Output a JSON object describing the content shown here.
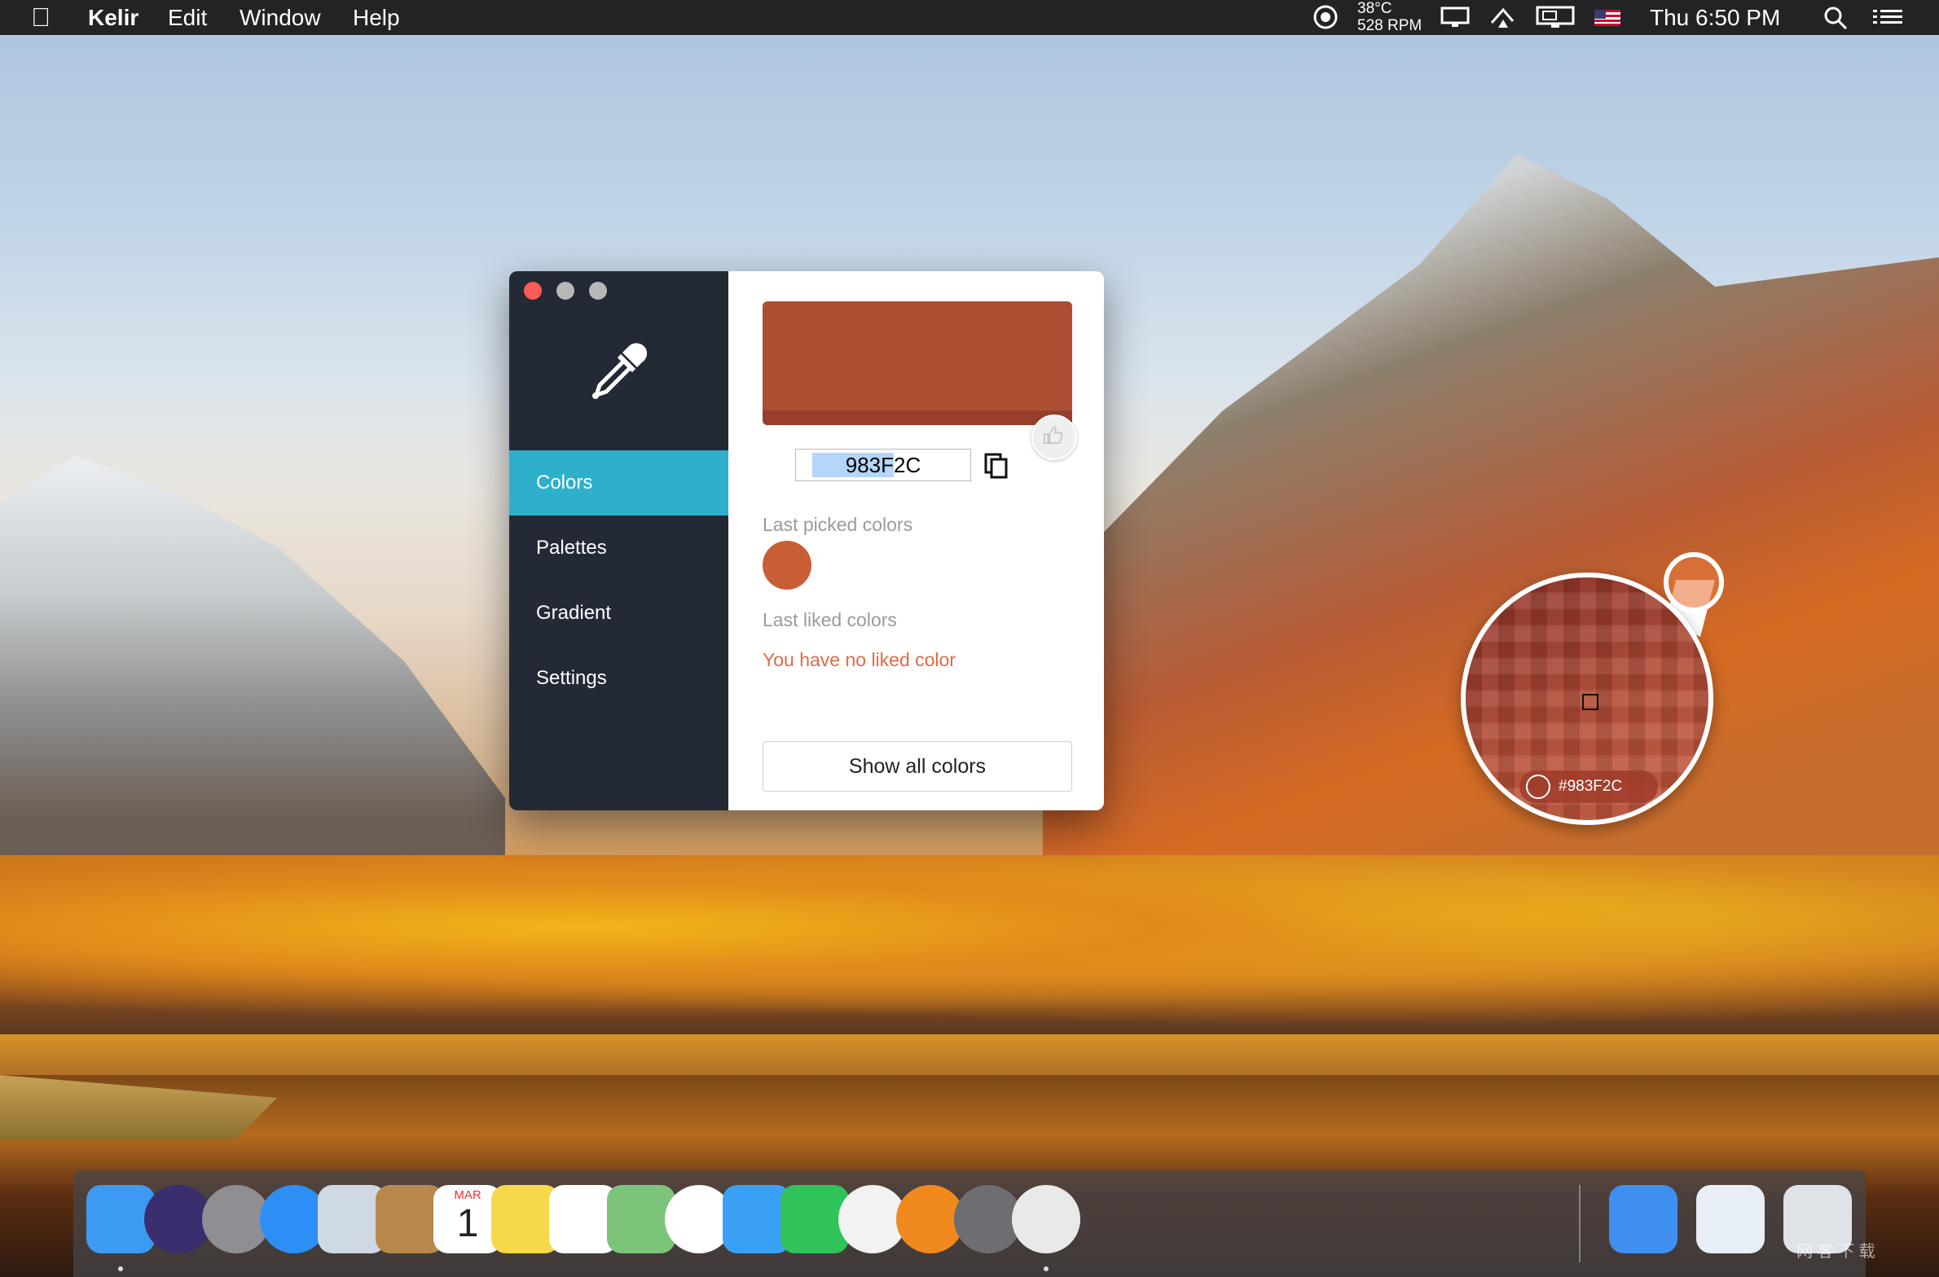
{
  "menubar": {
    "apple_glyph": "",
    "app_name": "Kelir",
    "menus": [
      "Edit",
      "Window",
      "Help"
    ],
    "temperature": "38°C",
    "fan_speed": "528 RPM",
    "clock": "Thu 6:50 PM",
    "status_icons": [
      "fan-monitor-icon",
      "display-icon",
      "airplay-icon",
      "screen-mirroring-icon",
      "us-flag-icon",
      "spotlight-icon",
      "notification-center-icon"
    ]
  },
  "window": {
    "sidebar": {
      "logo_icon": "eyedropper-icon",
      "items": [
        {
          "label": "Colors",
          "active": true
        },
        {
          "label": "Palettes",
          "active": false
        },
        {
          "label": "Gradient",
          "active": false
        },
        {
          "label": "Settings",
          "active": false
        }
      ]
    },
    "main": {
      "current_color": "#983F2C",
      "swatch_color": "#ad4f33",
      "hex_value": "983F2C",
      "last_picked_label": "Last picked colors",
      "last_picked_colors": [
        "#c85e36"
      ],
      "last_liked_label": "Last liked colors",
      "no_liked_message": "You have no liked color",
      "show_all_label": "Show all colors"
    }
  },
  "magnifier": {
    "hex_label": "#983F2C"
  },
  "dock": {
    "apps": [
      {
        "name": "finder-icon",
        "color": "#3d9af2"
      },
      {
        "name": "siri-icon",
        "color": "#3b2e6e"
      },
      {
        "name": "launchpad-icon",
        "color": "#8e8e93"
      },
      {
        "name": "safari-icon",
        "color": "#2d8ef5"
      },
      {
        "name": "mail-icon",
        "color": "#cfd9e3"
      },
      {
        "name": "contacts-icon",
        "color": "#b8874b"
      },
      {
        "name": "calendar-icon",
        "color": "#ffffff"
      },
      {
        "name": "notes-icon",
        "color": "#f7d84a"
      },
      {
        "name": "reminders-icon",
        "color": "#ffffff"
      },
      {
        "name": "maps-icon",
        "color": "#7cc47a"
      },
      {
        "name": "photos-icon",
        "color": "#ffffff"
      },
      {
        "name": "messages-icon",
        "color": "#3aa0f5"
      },
      {
        "name": "facetime-icon",
        "color": "#30c35a"
      },
      {
        "name": "itunes-icon",
        "color": "#f2f2f2"
      },
      {
        "name": "ibooks-icon",
        "color": "#f08a1e"
      },
      {
        "name": "system-preferences-icon",
        "color": "#6d6d72"
      },
      {
        "name": "kelir-icon",
        "color": "#e9e9e9"
      }
    ],
    "extras": [
      {
        "name": "downloads-icon",
        "color": "#3f8ff0"
      },
      {
        "name": "documents-icon",
        "color": "#e8eef6"
      },
      {
        "name": "trash-icon",
        "color": "#dfe3e8"
      }
    ],
    "calendar_month": "MAR",
    "calendar_day": "1"
  },
  "watermark": "网 客 下 载"
}
